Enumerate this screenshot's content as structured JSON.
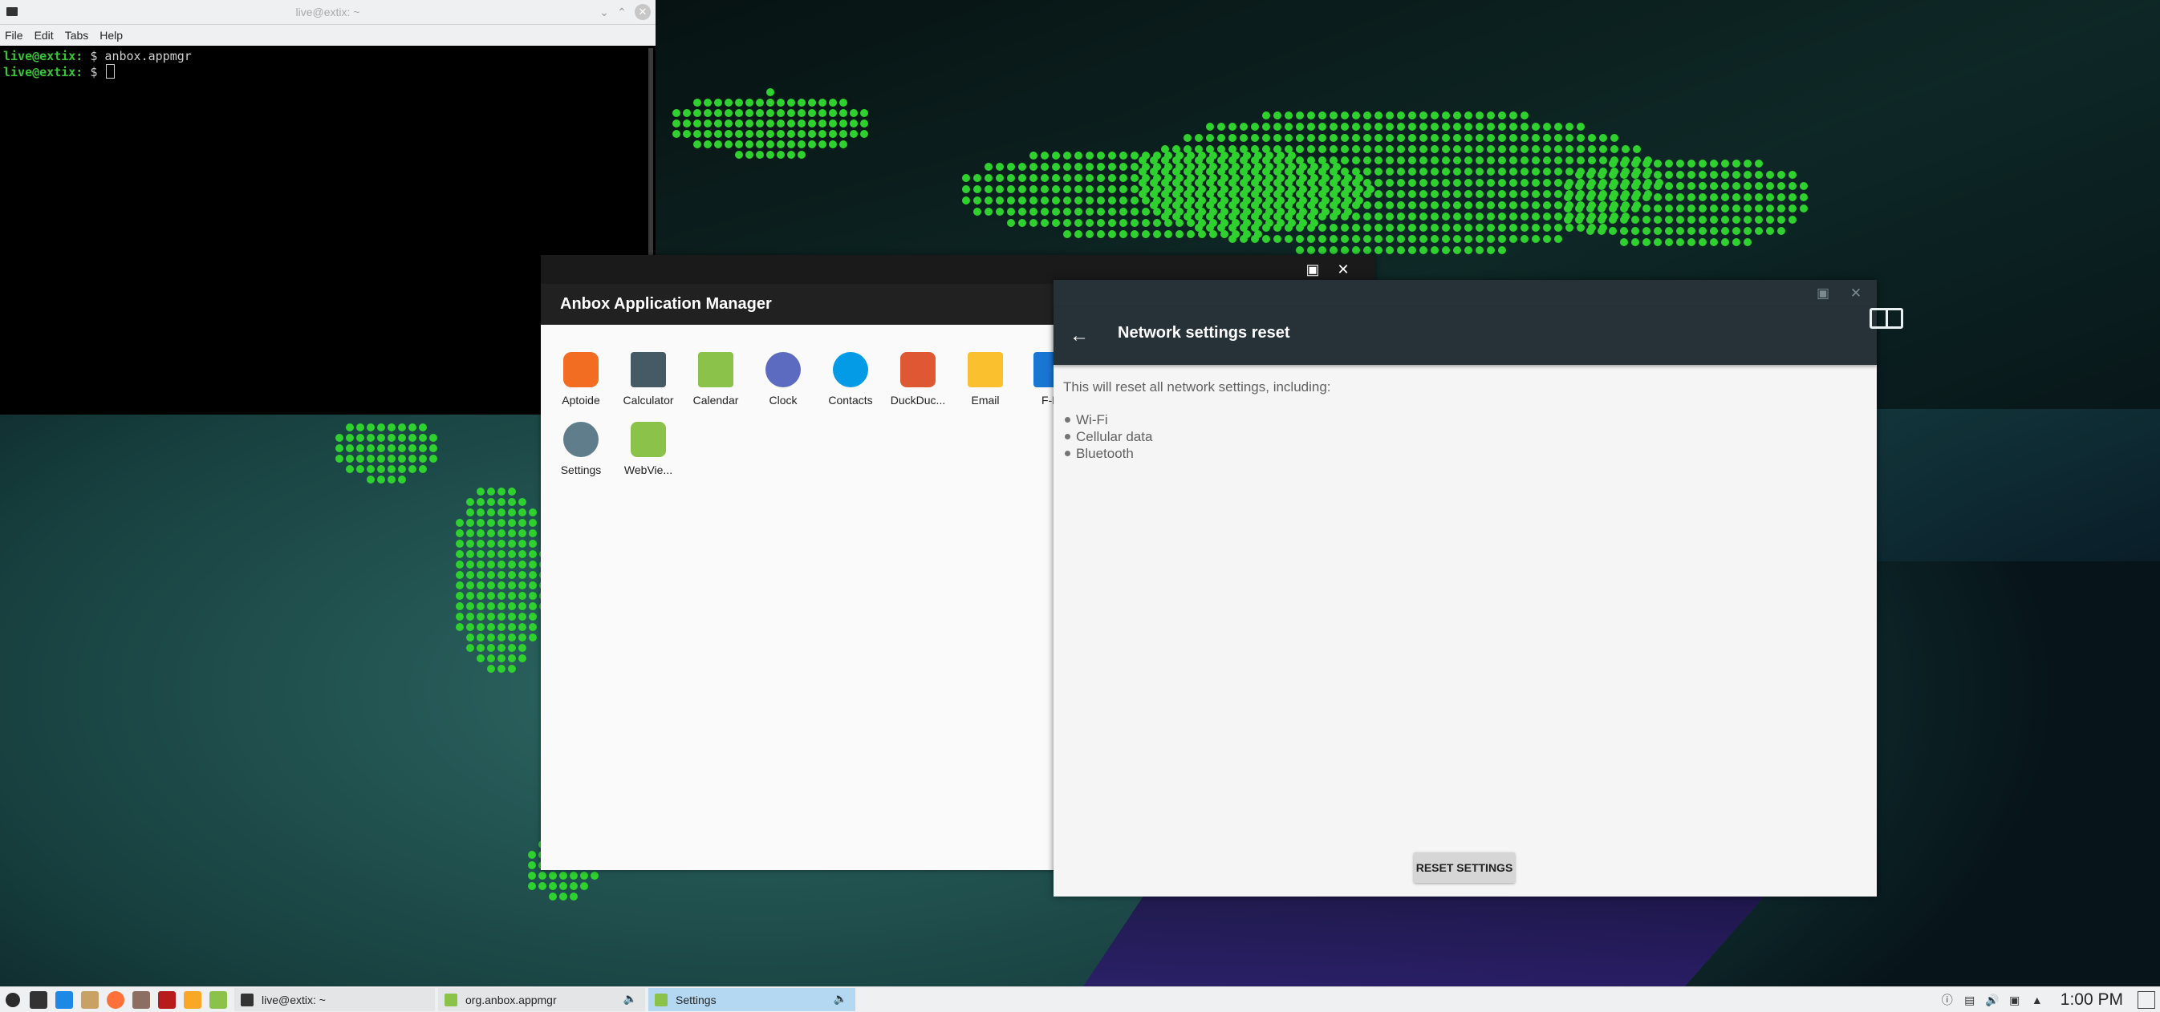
{
  "terminal": {
    "title": "live@extix: ~",
    "menu": [
      "File",
      "Edit",
      "Tabs",
      "Help"
    ],
    "lines": [
      {
        "prompt": "live@extix:",
        "text": " $ anbox.appmgr"
      },
      {
        "prompt": "live@extix:",
        "text": " $ "
      }
    ]
  },
  "appmgr": {
    "title": "Anbox Application Manager",
    "apps": [
      {
        "label": "Aptoide",
        "icon": "aptoide-icon",
        "color": "#f26d21"
      },
      {
        "label": "Calculator",
        "icon": "calculator-icon",
        "color": "#455a64"
      },
      {
        "label": "Calendar",
        "icon": "calendar-icon",
        "color": "#8bc34a"
      },
      {
        "label": "Clock",
        "icon": "clock-icon",
        "color": "#5c6bc0"
      },
      {
        "label": "Contacts",
        "icon": "contacts-icon",
        "color": "#039be5"
      },
      {
        "label": "DuckDuc...",
        "icon": "duckduckgo-icon",
        "color": "#de5833"
      },
      {
        "label": "Email",
        "icon": "email-icon",
        "color": "#fbc02d"
      },
      {
        "label": "F-Dr",
        "icon": "fdroid-icon",
        "color": "#1976d2"
      },
      {
        "label": "Settings",
        "icon": "settings-icon",
        "color": "#607d8b"
      },
      {
        "label": "WebVie...",
        "icon": "webview-icon",
        "color": "#8bc34a"
      }
    ]
  },
  "settings": {
    "title": "Network settings reset",
    "intro": "This will reset all network settings, including:",
    "items": [
      "Wi-Fi",
      "Cellular data",
      "Bluetooth"
    ],
    "button": "RESET SETTINGS"
  },
  "taskbar": {
    "launchers": [
      {
        "name": "app-menu-icon",
        "color": "#2c2c2c"
      },
      {
        "name": "terminal-launcher-icon",
        "color": "#333333"
      },
      {
        "name": "file-manager-launcher-icon",
        "color": "#1e88e5"
      },
      {
        "name": "archive-launcher-icon",
        "color": "#c8a165"
      },
      {
        "name": "firefox-launcher-icon",
        "color": "#ff7139"
      },
      {
        "name": "gimp-launcher-icon",
        "color": "#8d6e63"
      },
      {
        "name": "app-launcher-icon",
        "color": "#b71c1c"
      },
      {
        "name": "download-launcher-icon",
        "color": "#f9a825"
      },
      {
        "name": "android-launcher-icon",
        "color": "#8bc34a"
      }
    ],
    "tasks": [
      {
        "label": "live@extix: ~",
        "icon": "terminal-task-icon",
        "color": "#333333",
        "active": false,
        "audio": false
      },
      {
        "label": "org.anbox.appmgr",
        "icon": "appmgr-task-icon",
        "color": "#8bc34a",
        "active": false,
        "audio": true
      },
      {
        "label": "Settings",
        "icon": "settings-task-icon",
        "color": "#8bc34a",
        "active": true,
        "audio": true
      }
    ],
    "clock": "1:00 PM"
  },
  "colors": {
    "accent": "#263238",
    "wallpaper_dots": "#2ed12e",
    "active_task": "#b5d8f2"
  }
}
